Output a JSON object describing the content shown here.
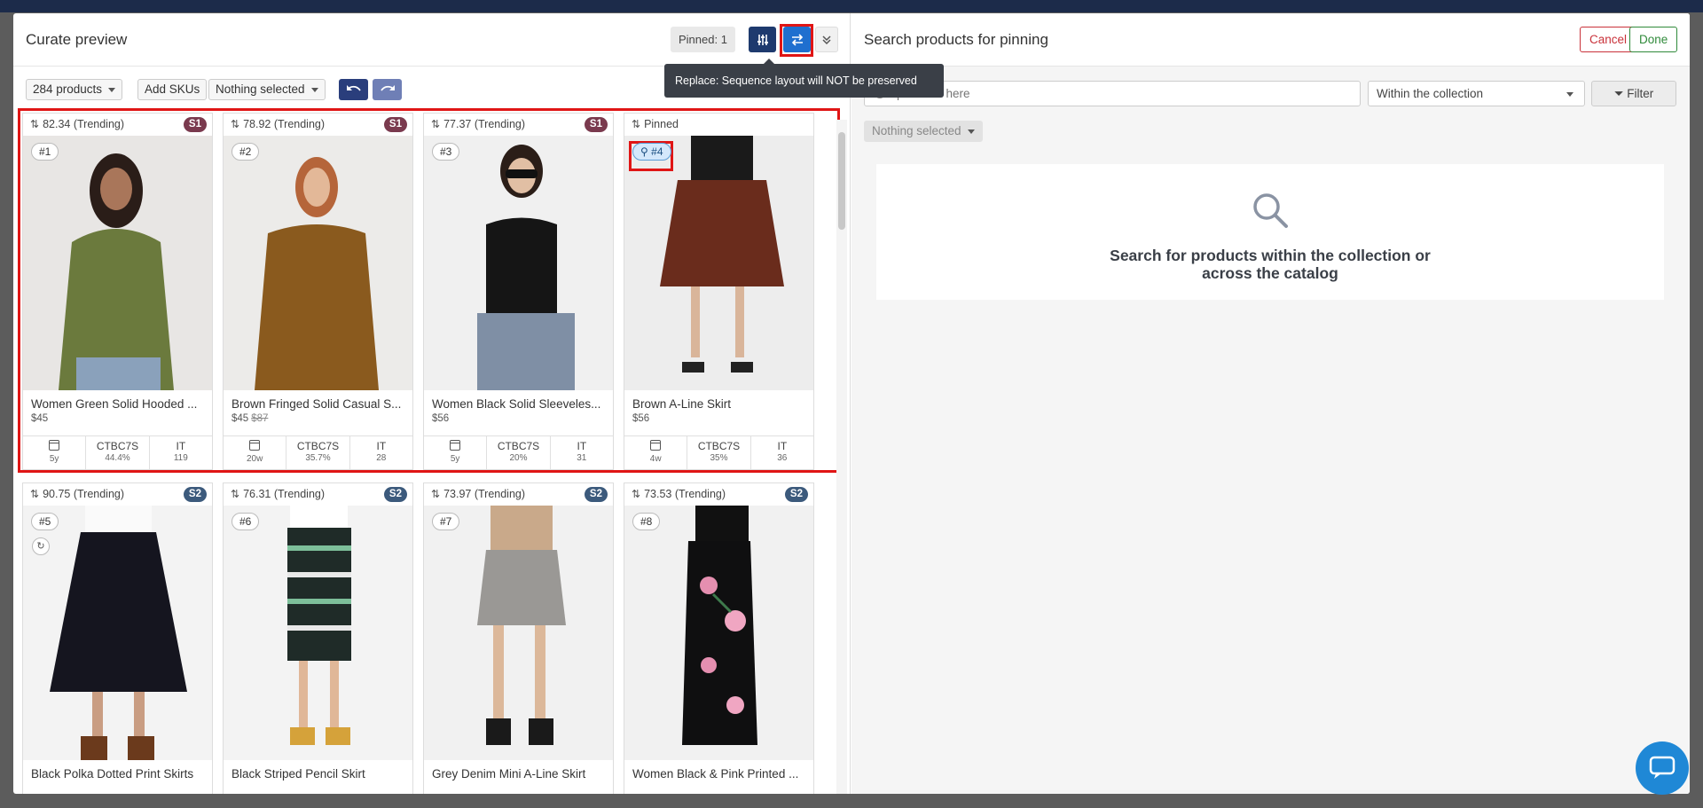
{
  "left": {
    "title": "Curate preview",
    "pinned_label": "Pinned: 1",
    "tooltip": "Replace: Sequence layout will NOT be preserved",
    "toolbar": {
      "products_count": "284 products",
      "add_skus": "Add SKUs",
      "selection": "Nothing selected"
    }
  },
  "products": [
    {
      "score": "82.34 (Trending)",
      "slot": "S1",
      "rank": "#1",
      "name": "Women Green Solid Hooded ...",
      "price": "$45",
      "old_price": "",
      "age": "5y",
      "ctbc": "44.4%",
      "it": "119"
    },
    {
      "score": "78.92 (Trending)",
      "slot": "S1",
      "rank": "#2",
      "name": "Brown Fringed Solid Casual S...",
      "price": "$45",
      "old_price": "$87",
      "age": "20w",
      "ctbc": "35.7%",
      "it": "28"
    },
    {
      "score": "77.37 (Trending)",
      "slot": "S1",
      "rank": "#3",
      "name": "Women Black Solid Sleeveles...",
      "price": "$56",
      "old_price": "",
      "age": "5y",
      "ctbc": "20%",
      "it": "31"
    },
    {
      "score": "Pinned",
      "slot": "",
      "rank": "#4",
      "name": "Brown A-Line Skirt",
      "price": "$56",
      "old_price": "",
      "age": "4w",
      "ctbc": "35%",
      "it": "36"
    },
    {
      "score": "90.75 (Trending)",
      "slot": "S2",
      "rank": "#5",
      "name": "Black Polka Dotted Print Skirts",
      "price": "",
      "old_price": "",
      "age": "",
      "ctbc": "",
      "it": ""
    },
    {
      "score": "76.31 (Trending)",
      "slot": "S2",
      "rank": "#6",
      "name": "Black Striped Pencil Skirt",
      "price": "",
      "old_price": "",
      "age": "",
      "ctbc": "",
      "it": ""
    },
    {
      "score": "73.97 (Trending)",
      "slot": "S2",
      "rank": "#7",
      "name": "Grey Denim Mini A-Line Skirt",
      "price": "",
      "old_price": "",
      "age": "",
      "ctbc": "",
      "it": ""
    },
    {
      "score": "73.53 (Trending)",
      "slot": "S2",
      "rank": "#8",
      "name": "Women Black & Pink Printed ...",
      "price": "",
      "old_price": "",
      "age": "",
      "ctbc": "",
      "it": ""
    }
  ],
  "stat_labels": {
    "ctbc": "CTBC7S",
    "it": "IT"
  },
  "right": {
    "title": "Search products for pinning",
    "cancel": "Cancel",
    "done": "Done",
    "search_placeholder": "products here",
    "scope": "Within the collection",
    "filter": "Filter",
    "selection": "Nothing selected",
    "empty_message_line1": "Search for products within the collection or",
    "empty_message_line2": "across the catalog"
  },
  "colors": {
    "slot_s1": "#7a3a4e",
    "slot_s2": "#3c5a7c",
    "primary": "#1f6fcf",
    "highlight": "#e01515"
  }
}
